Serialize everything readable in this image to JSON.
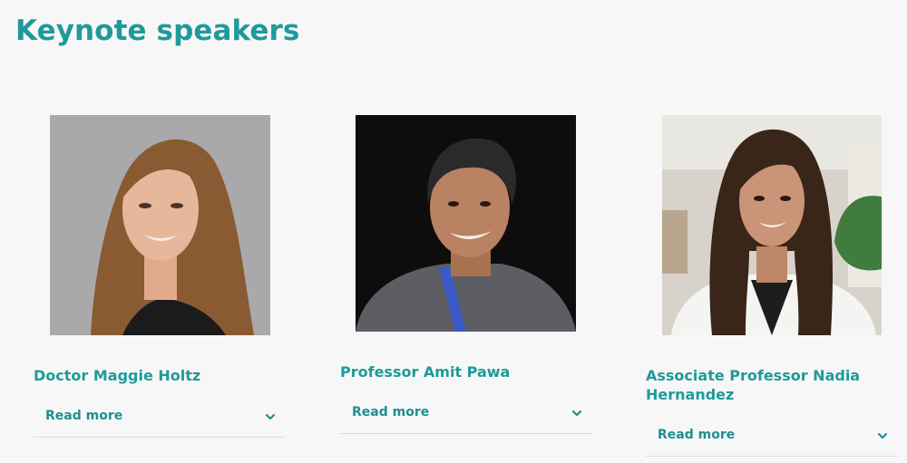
{
  "page": {
    "title": "Keynote speakers"
  },
  "speakers": [
    {
      "name": "Doctor Maggie Holtz",
      "read_more": "Read more",
      "photo_background": "#a9a9ab",
      "photo_hair": "#8a5a33",
      "photo_skin": "#e7b79b",
      "photo_clothing": "#1b1b1b"
    },
    {
      "name": "Professor Amit Pawa",
      "read_more": "Read more",
      "photo_background": "#0e0c0d",
      "photo_hair": "#2b2a2b",
      "photo_skin": "#b98262",
      "photo_clothing": "#5c5e63",
      "photo_lanyard": "#3b58c8"
    },
    {
      "name": "Associate Professor Nadia Hernandez",
      "read_more": "Read more",
      "photo_background": "#d7d3cb",
      "photo_hair": "#3a2519",
      "photo_skin": "#c99478",
      "photo_clothing": "#f4f4f2",
      "photo_plant": "#3f7c3d"
    }
  ],
  "colors": {
    "accent": "#1e9a9a",
    "divider": "#dcdcdc",
    "background": "#f8f7f8"
  },
  "icons": {
    "expand": "chevron-down-icon"
  }
}
